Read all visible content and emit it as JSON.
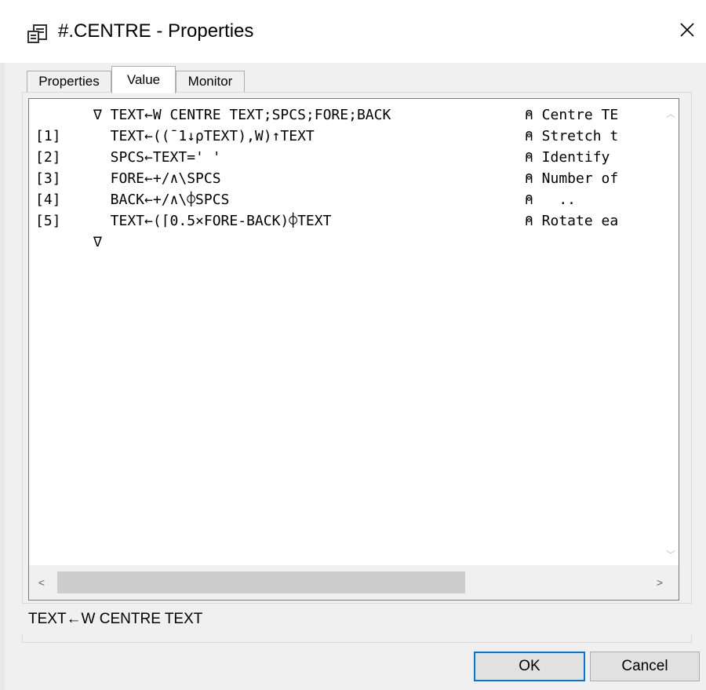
{
  "window": {
    "title": "#.CENTRE - Properties",
    "close_glyph": "✕"
  },
  "tabs": [
    {
      "label": "Properties",
      "active": false
    },
    {
      "label": "Value",
      "active": true
    },
    {
      "label": "Monitor",
      "active": false
    }
  ],
  "editor": {
    "lines": [
      {
        "num": "",
        "code": "∇ TEXT←W CENTRE TEXT;SPCS;FORE;BACK",
        "comment": "⍝ Centre TE"
      },
      {
        "num": "[1]",
        "code": "  TEXT←((¯1↓⍴TEXT),W)↑TEXT",
        "comment": "⍝ Stretch t"
      },
      {
        "num": "[2]",
        "code": "  SPCS←TEXT=' '",
        "comment": "⍝ Identify "
      },
      {
        "num": "[3]",
        "code": "  FORE←+/∧\\SPCS",
        "comment": "⍝ Number of"
      },
      {
        "num": "[4]",
        "code": "  BACK←+/∧\\⌽SPCS",
        "comment": "⍝   .."
      },
      {
        "num": "[5]",
        "code": "  TEXT←(⌈0.5×FORE-BACK)⌽TEXT",
        "comment": "⍝ Rotate ea"
      },
      {
        "num": "",
        "code": "∇",
        "comment": ""
      }
    ]
  },
  "scrollbars": {
    "up_arrow": "︿",
    "down_arrow": "﹀",
    "left_arrow": "<",
    "right_arrow": ">"
  },
  "status": {
    "text": "TEXT←W CENTRE TEXT"
  },
  "buttons": {
    "ok_label": "OK",
    "cancel_label": "Cancel"
  }
}
